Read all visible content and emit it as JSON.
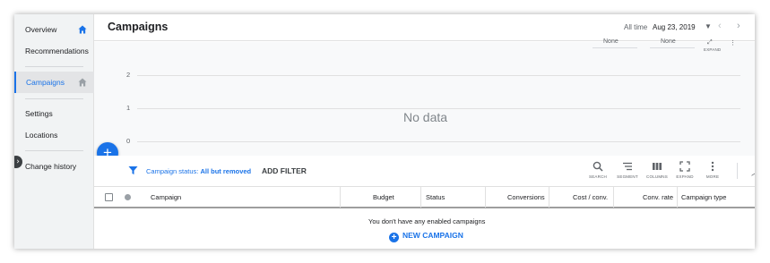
{
  "sidebar": {
    "items": [
      {
        "label": "Overview"
      },
      {
        "label": "Recommendations"
      },
      {
        "label": "Campaigns"
      },
      {
        "label": "Settings"
      },
      {
        "label": "Locations"
      },
      {
        "label": "Change history"
      }
    ]
  },
  "header": {
    "title": "Campaigns",
    "date_label": "All time",
    "date_value": "Aug 23, 2019"
  },
  "chart": {
    "metric_1": "None",
    "metric_2": "None",
    "expand_label": "EXPAND",
    "y_ticks": [
      "2",
      "1",
      "0"
    ],
    "empty_text": "No data"
  },
  "filter": {
    "label": "Campaign status:",
    "value": "All but removed",
    "add_filter": "ADD FILTER"
  },
  "toolbar": {
    "search": "SEARCH",
    "segment": "SEGMENT",
    "columns": "COLUMNS",
    "expand": "EXPAND",
    "more": "MORE"
  },
  "table": {
    "columns": [
      "Campaign",
      "Budget",
      "Status",
      "Conversions",
      "Cost / conv.",
      "Conv. rate",
      "Campaign type"
    ],
    "empty_message": "You don't have any enabled campaigns",
    "new_campaign": "NEW CAMPAIGN"
  },
  "colors": {
    "accent": "#1a73e8",
    "sidebar_bg": "#f1f3f4"
  }
}
